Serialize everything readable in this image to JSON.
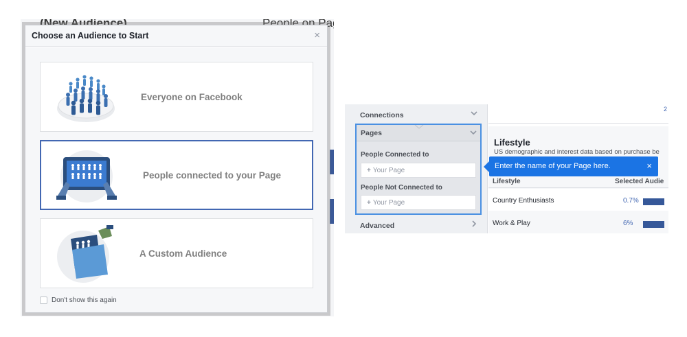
{
  "left_screen": {
    "bg_title_left": "(New Audience)",
    "bg_title_right": "People on Page",
    "modal": {
      "title": "Choose an Audience to Start",
      "close_glyph": "×",
      "options": [
        {
          "label": "Everyone on Facebook",
          "icon": "crowd-illustration-icon",
          "selected": false
        },
        {
          "label": "People connected to your Page",
          "icon": "tablet-page-illustration-icon",
          "selected": true
        },
        {
          "label": "A Custom Audience",
          "icon": "custom-folder-illustration-icon",
          "selected": false
        }
      ],
      "dont_show_label": "Don't show this again",
      "dont_show_checked": false
    }
  },
  "right_screen": {
    "sidebar": {
      "connections_label": "Connections",
      "pages_label": "Pages",
      "connected_label": "People Connected to",
      "connected_placeholder": "Your Page",
      "not_connected_label": "People Not Connected to",
      "not_connected_placeholder": "Your Page",
      "advanced_label": "Advanced"
    },
    "top_number": "2",
    "lifestyle": {
      "title": "Lifestyle",
      "description": "US demographic and interest data based on purchase be",
      "col_lifestyle": "Lifestyle",
      "col_selected": "Selected Audie",
      "rows": [
        {
          "name": "Country Enthusiasts",
          "pct": "0.7%",
          "fraction": 0.7
        },
        {
          "name": "Work & Play",
          "pct": "6%",
          "fraction": 0.6
        }
      ]
    },
    "tooltip": {
      "text": "Enter the name of your Page here.",
      "close_glyph": "×"
    }
  },
  "colors": {
    "facebook_blue": "#4267b2",
    "tooltip_blue": "#1b74e4",
    "highlight_border": "#4a90e2",
    "bar_blue": "#365899"
  }
}
